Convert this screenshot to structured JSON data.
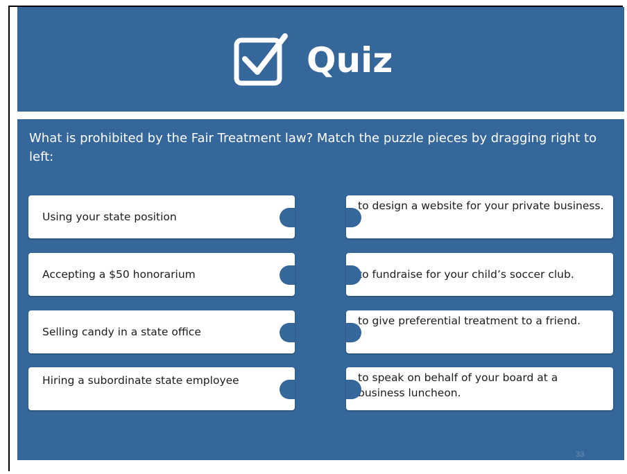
{
  "header": {
    "title": "Quiz",
    "icon": "checkbox-check-icon"
  },
  "question": "What is prohibited by the Fair Treatment law?   Match the puzzle pieces by dragging right to left:",
  "left_pieces": [
    {
      "label": "Using your state position"
    },
    {
      "label": "Accepting a $50 honorarium"
    },
    {
      "label": "Selling candy  in a state office"
    },
    {
      "label": "Hiring a subordinate state employee"
    }
  ],
  "right_pieces": [
    {
      "label": "to design a website for your private business."
    },
    {
      "label": "to fundraise for your child’s soccer club."
    },
    {
      "label": "to give preferential treatment to a friend."
    },
    {
      "label": "to speak on behalf of your board at a business luncheon."
    }
  ],
  "slide_number": "33",
  "colors": {
    "primary": "#35679a",
    "piece": "#ffffff",
    "text": "#1c1c1c"
  }
}
